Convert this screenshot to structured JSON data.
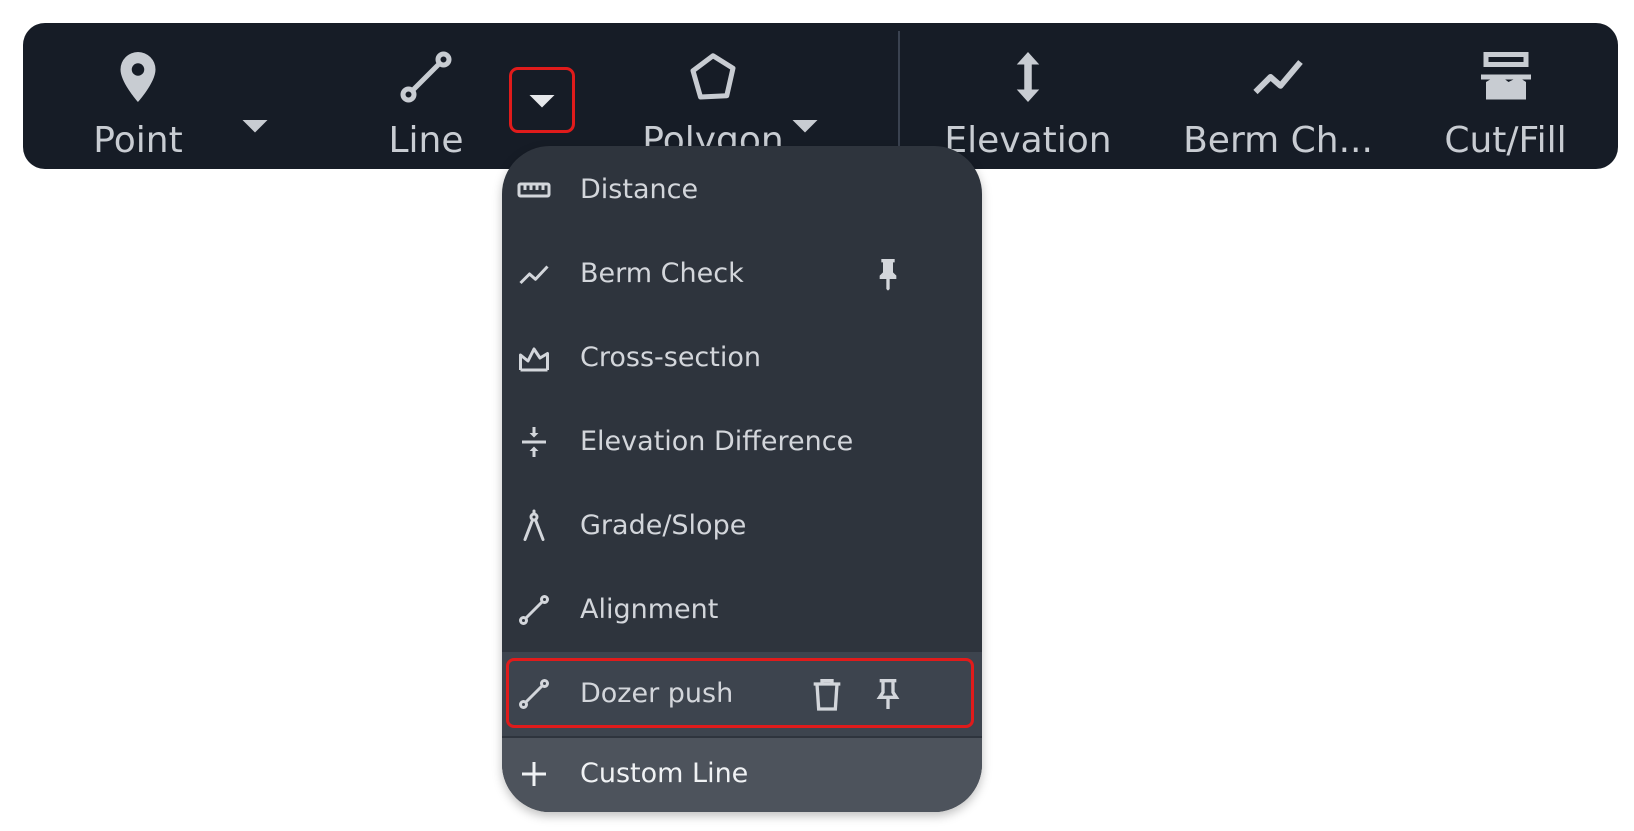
{
  "toolbar": {
    "tools": [
      {
        "label": "Point",
        "icon": "map-pin-icon"
      },
      {
        "label": "Line",
        "icon": "line-tool-icon"
      },
      {
        "label": "Polygon",
        "icon": "polygon-icon"
      },
      {
        "label": "Elevation",
        "icon": "vertical-arrows-icon"
      },
      {
        "label": "Berm Ch...",
        "icon": "trend-line-icon"
      },
      {
        "label": "Cut/Fill",
        "icon": "cut-fill-icon"
      }
    ]
  },
  "line_menu": {
    "items": [
      {
        "label": "Distance",
        "icon": "ruler-icon"
      },
      {
        "label": "Berm Check",
        "icon": "trend-line-icon",
        "pinned": true
      },
      {
        "label": "Cross-section",
        "icon": "cross-section-icon"
      },
      {
        "label": "Elevation Difference",
        "icon": "elevation-difference-icon"
      },
      {
        "label": "Grade/Slope",
        "icon": "compass-icon"
      },
      {
        "label": "Alignment",
        "icon": "line-tool-icon"
      },
      {
        "label": "Dozer push",
        "icon": "line-tool-icon",
        "actions": [
          "trash-icon",
          "pin-icon"
        ]
      }
    ],
    "custom_label": "Custom Line"
  },
  "colors": {
    "toolbar_bg": "#161c26",
    "menu_bg": "#2e343d",
    "highlight": "#e01b1b"
  }
}
